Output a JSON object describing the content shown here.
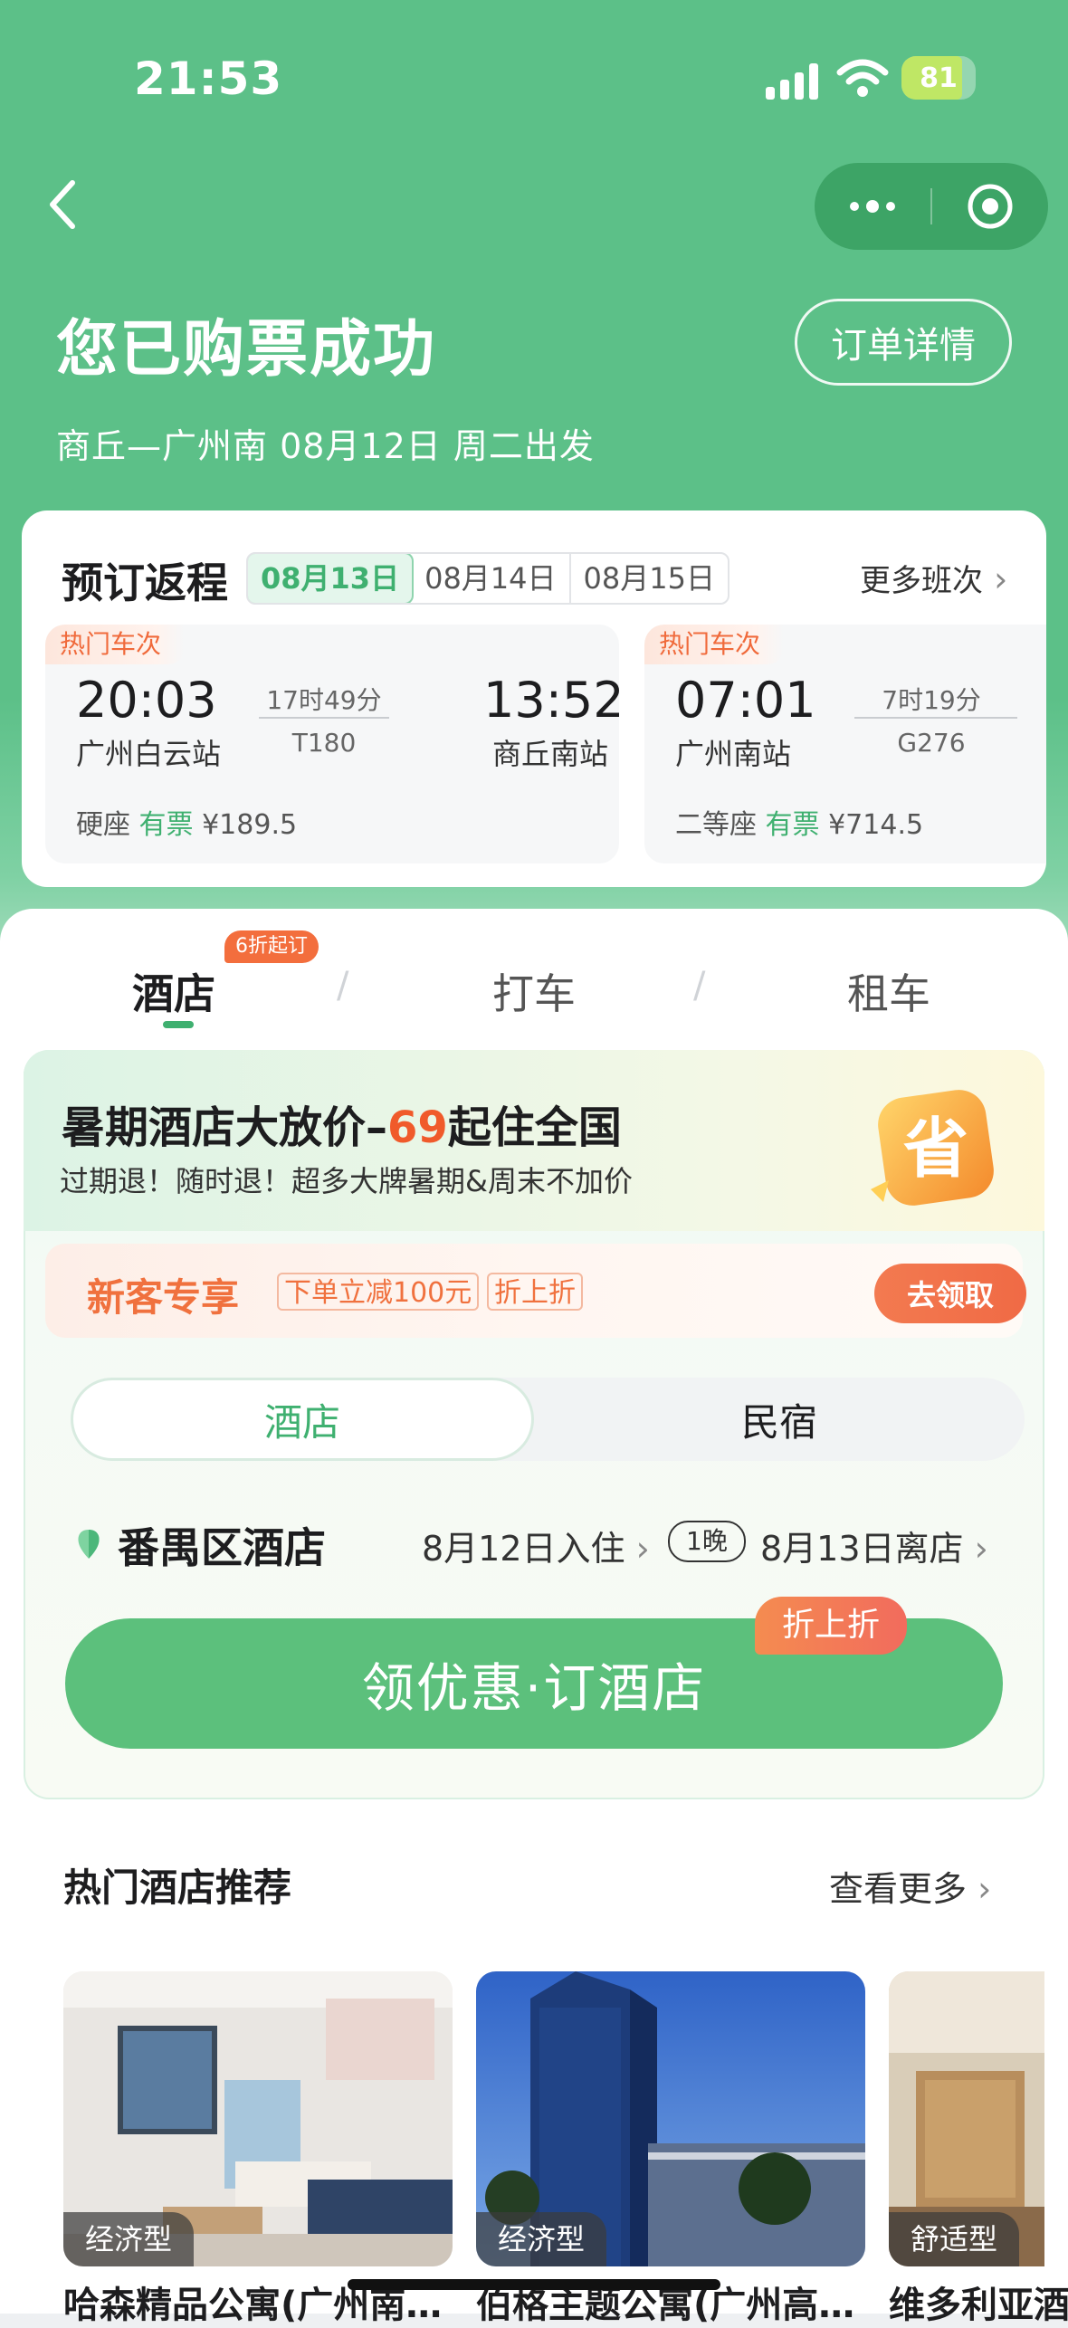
{
  "status_bar": {
    "time": "21:53",
    "battery": "81"
  },
  "header": {
    "title": "您已购票成功",
    "order_button": "订单详情",
    "subtitle": "商丘—广州南 08月12日 周二出发"
  },
  "return_trip": {
    "title": "预订返程",
    "dates": [
      "08月13日",
      "08月14日",
      "08月15日"
    ],
    "more_label": "更多班次",
    "trains": [
      {
        "tag": "热门车次",
        "depart_time": "20:03",
        "depart_station": "广州白云站",
        "duration": "17时49分",
        "train_no": "T180",
        "arrive_time": "13:52",
        "arrive_station": "商丘南站",
        "seat": "硬座",
        "availability": "有票",
        "price": "¥189.5"
      },
      {
        "tag": "热门车次",
        "depart_time": "07:01",
        "depart_station": "广州南站",
        "duration": "7时19分",
        "train_no": "G276",
        "seat": "二等座",
        "availability": "有票",
        "price": "¥714.5"
      }
    ]
  },
  "service_tabs": {
    "hotel": "酒店",
    "taxi": "打车",
    "rental": "租车",
    "hotel_badge": "6折起订"
  },
  "promo": {
    "title_prefix": "暑期酒店大放价–",
    "title_highlight": "69",
    "title_suffix": "起住全国",
    "subtitle": "过期退！随时退！超多大牌暑期&周末不加价",
    "sheng_char": "省",
    "new_customer": {
      "title": "新客专享",
      "tag1": "下单立减100元",
      "tag2": "折上折",
      "claim": "去领取"
    },
    "segment": {
      "hotel": "酒店",
      "homestay": "民宿"
    },
    "location": "番禺区酒店",
    "checkin": "8月12日入住",
    "nights": "1晚",
    "checkout": "8月13日离店",
    "cta": "领优惠·订酒店",
    "cta_badge": "折上折"
  },
  "recommend": {
    "title": "热门酒店推荐",
    "more": "查看更多",
    "hotels": [
      {
        "category": "经济型",
        "name": "哈森精品公寓(广州南…"
      },
      {
        "category": "经济型",
        "name": "伯格主题公寓(广州高…"
      },
      {
        "category": "舒适型",
        "name": "维多利亚酒"
      }
    ]
  },
  "colors": {
    "brand_green": "#5cc088",
    "accent_orange": "#f0713e",
    "price_red": "#f05a2b"
  }
}
